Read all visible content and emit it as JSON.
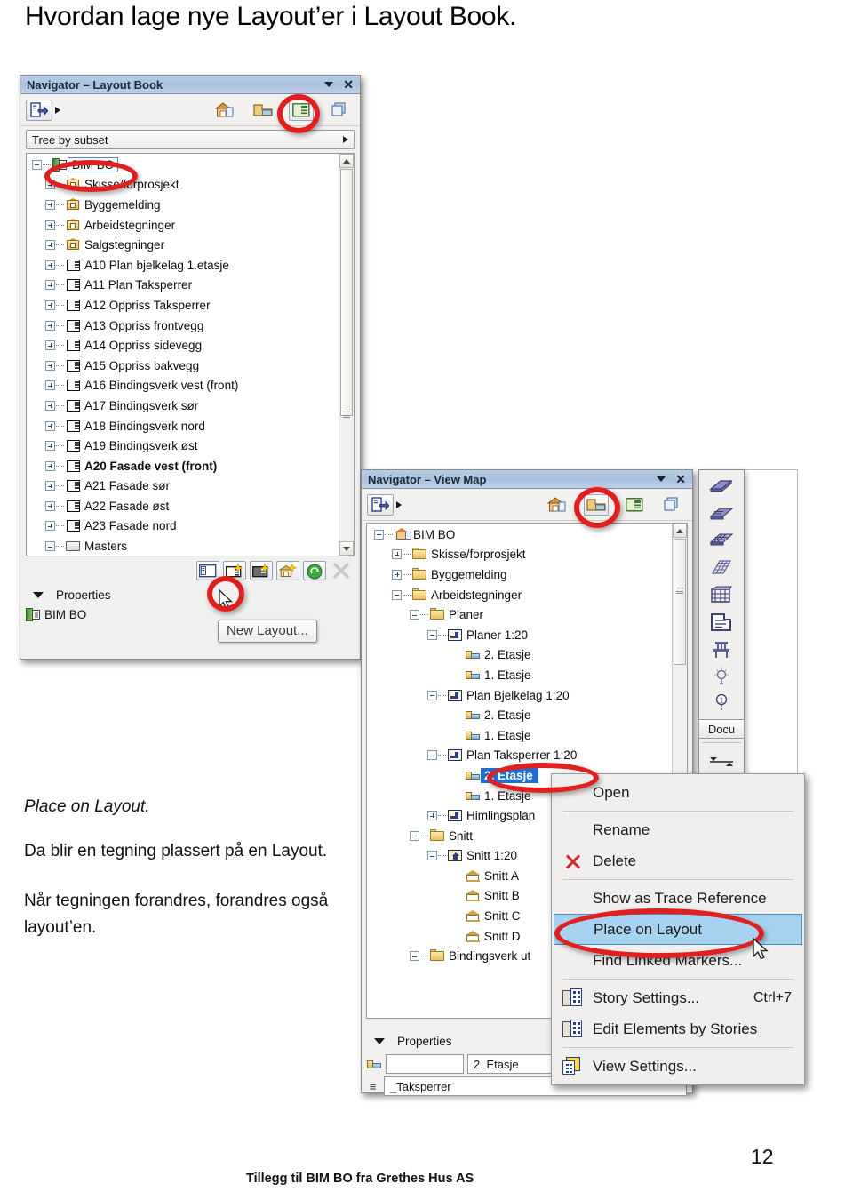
{
  "document": {
    "title": "Hvordan lage nye Layout’er i Layout Book.",
    "footer": "Tillegg til BIM BO fra Grethes Hus AS",
    "page_number": "12"
  },
  "body_text": {
    "italic_line": "Place on Layout.",
    "paragraph1": "Da blir en tegning plassert på en Layout.",
    "paragraph2": "Når tegningen forandres, forandres også layout’en."
  },
  "layout_book_panel": {
    "title": "Navigator – Layout Book",
    "caret_icon": "chevron-down-icon",
    "close_icon": "close-icon",
    "toolbar": {
      "publisher_icon": "publisher-arrow-icon",
      "project_map_icon": "project-map-icon",
      "view_map_icon": "view-map-icon",
      "layout_book_icon": "layout-book-icon",
      "publisher_sets_icon": "publisher-sets-icon"
    },
    "combo_value": "Tree by subset",
    "combo_arrow_icon": "chevron-right-icon",
    "tree": [
      {
        "label": "BIM BO",
        "icon": "layout-book-root-icon",
        "indent": 0,
        "expander": "minus",
        "selected": true,
        "bold": false
      },
      {
        "label": "Skisse/forprosjekt",
        "icon": "subset-icon",
        "indent": 1,
        "expander": "plus",
        "selected": false,
        "bold": false
      },
      {
        "label": "Byggemelding",
        "icon": "subset-icon",
        "indent": 1,
        "expander": "plus",
        "selected": false,
        "bold": false
      },
      {
        "label": "Arbeidstegninger",
        "icon": "subset-icon",
        "indent": 1,
        "expander": "plus",
        "selected": false,
        "bold": false
      },
      {
        "label": "Salgstegninger",
        "icon": "subset-icon",
        "indent": 1,
        "expander": "plus",
        "selected": false,
        "bold": false
      },
      {
        "label": "A10 Plan bjelkelag 1.etasje",
        "icon": "layout-icon",
        "indent": 1,
        "expander": "plus",
        "selected": false,
        "bold": false
      },
      {
        "label": "A11 Plan Taksperrer",
        "icon": "layout-icon",
        "indent": 1,
        "expander": "plus",
        "selected": false,
        "bold": false
      },
      {
        "label": "A12 Oppriss Taksperrer",
        "icon": "layout-icon",
        "indent": 1,
        "expander": "plus",
        "selected": false,
        "bold": false
      },
      {
        "label": "A13 Oppriss frontvegg",
        "icon": "layout-icon",
        "indent": 1,
        "expander": "plus",
        "selected": false,
        "bold": false
      },
      {
        "label": "A14 Oppriss sidevegg",
        "icon": "layout-icon",
        "indent": 1,
        "expander": "plus",
        "selected": false,
        "bold": false
      },
      {
        "label": "A15 Oppriss bakvegg",
        "icon": "layout-icon",
        "indent": 1,
        "expander": "plus",
        "selected": false,
        "bold": false
      },
      {
        "label": "A16 Bindingsverk vest (front)",
        "icon": "layout-icon",
        "indent": 1,
        "expander": "plus",
        "selected": false,
        "bold": false
      },
      {
        "label": "A17 Bindingsverk sør",
        "icon": "layout-icon",
        "indent": 1,
        "expander": "plus",
        "selected": false,
        "bold": false
      },
      {
        "label": "A18 Bindingsverk nord",
        "icon": "layout-icon",
        "indent": 1,
        "expander": "plus",
        "selected": false,
        "bold": false
      },
      {
        "label": "A19 Bindingsverk øst",
        "icon": "layout-icon",
        "indent": 1,
        "expander": "plus",
        "selected": false,
        "bold": false
      },
      {
        "label": "A20 Fasade vest (front)",
        "icon": "layout-icon",
        "indent": 1,
        "expander": "plus",
        "selected": false,
        "bold": true
      },
      {
        "label": "A21 Fasade sør",
        "icon": "layout-icon",
        "indent": 1,
        "expander": "plus",
        "selected": false,
        "bold": false
      },
      {
        "label": "A22 Fasade øst",
        "icon": "layout-icon",
        "indent": 1,
        "expander": "plus",
        "selected": false,
        "bold": false
      },
      {
        "label": "A23 Fasade nord",
        "icon": "layout-icon",
        "indent": 1,
        "expander": "plus",
        "selected": false,
        "bold": false
      },
      {
        "label": "Masters",
        "icon": "masters-folder-icon",
        "indent": 1,
        "expander": "minus",
        "selected": false,
        "bold": false
      }
    ],
    "bottom_buttons": [
      "new-independent-layout-icon",
      "new-layout-icon",
      "new-master-layout-icon",
      "new-subset-icon",
      "update-icon",
      "delete-icon"
    ],
    "tooltip": "New Layout...",
    "properties_label": "Properties",
    "properties_value": "BIM BO"
  },
  "view_map_panel": {
    "title": "Navigator – View Map",
    "caret_icon": "chevron-down-icon",
    "close_icon": "close-icon",
    "toolbar": {
      "publisher_icon": "publisher-arrow-icon",
      "project_map_icon": "project-map-icon",
      "view_map_icon": "view-map-icon",
      "layout_book_icon": "layout-book-icon",
      "publisher_sets_icon": "publisher-sets-icon"
    },
    "tree": [
      {
        "label": "BIM BO",
        "icon": "project-icon",
        "indent": 0,
        "expander": "minus",
        "selected": false
      },
      {
        "label": "Skisse/forprosjekt",
        "icon": "folder-icon",
        "indent": 1,
        "expander": "plus",
        "selected": false
      },
      {
        "label": "Byggemelding",
        "icon": "folder-icon",
        "indent": 1,
        "expander": "plus",
        "selected": false
      },
      {
        "label": "Arbeidstegninger",
        "icon": "folder-icon",
        "indent": 1,
        "expander": "minus",
        "selected": false
      },
      {
        "label": "Planer",
        "icon": "folder-icon",
        "indent": 2,
        "expander": "minus",
        "selected": false
      },
      {
        "label": "Planer 1:20",
        "icon": "viewset-icon",
        "indent": 3,
        "expander": "minus",
        "selected": false
      },
      {
        "label": "2. Etasje",
        "icon": "view-icon",
        "indent": 4,
        "expander": "none",
        "selected": false
      },
      {
        "label": "1. Etasje",
        "icon": "view-icon",
        "indent": 4,
        "expander": "none",
        "selected": false
      },
      {
        "label": "Plan Bjelkelag 1:20",
        "icon": "viewset-icon",
        "indent": 3,
        "expander": "minus",
        "selected": false
      },
      {
        "label": "2. Etasje",
        "icon": "view-icon",
        "indent": 4,
        "expander": "none",
        "selected": false
      },
      {
        "label": "1. Etasje",
        "icon": "view-icon",
        "indent": 4,
        "expander": "none",
        "selected": false
      },
      {
        "label": "Plan Taksperrer 1:20",
        "icon": "viewset-icon",
        "indent": 3,
        "expander": "minus",
        "selected": false
      },
      {
        "label": "2. Etasje",
        "icon": "view-icon",
        "indent": 4,
        "expander": "none",
        "selected": true
      },
      {
        "label": "1. Etasje",
        "icon": "view-icon",
        "indent": 4,
        "expander": "none",
        "selected": false
      },
      {
        "label": "Himlingsplan",
        "icon": "viewset-icon",
        "indent": 3,
        "expander": "plus",
        "selected": false
      },
      {
        "label": "Snitt",
        "icon": "folder-icon",
        "indent": 2,
        "expander": "minus",
        "selected": false
      },
      {
        "label": "Snitt 1:20",
        "icon": "section-set-icon",
        "indent": 3,
        "expander": "minus",
        "selected": false
      },
      {
        "label": "Snitt A",
        "icon": "section-icon",
        "indent": 4,
        "expander": "none",
        "selected": false
      },
      {
        "label": "Snitt B",
        "icon": "section-icon",
        "indent": 4,
        "expander": "none",
        "selected": false
      },
      {
        "label": "Snitt C",
        "icon": "section-icon",
        "indent": 4,
        "expander": "none",
        "selected": false
      },
      {
        "label": "Snitt D",
        "icon": "section-icon",
        "indent": 4,
        "expander": "none",
        "selected": false
      },
      {
        "label": "Bindingsverk ut",
        "icon": "folder-icon",
        "indent": 2,
        "expander": "minus",
        "selected": false
      }
    ],
    "properties_label": "Properties",
    "properties_fields": {
      "left_value": "",
      "right_value": "2. Etasje",
      "second_row_value": "_Taksperrer"
    }
  },
  "context_menu": {
    "items": [
      {
        "label": "Open",
        "icon": "",
        "accel": "",
        "selected": false,
        "separator_after": true
      },
      {
        "label": "Rename",
        "icon": "",
        "accel": "",
        "selected": false,
        "separator_after": false
      },
      {
        "label": "Delete",
        "icon": "delete-x-icon",
        "accel": "",
        "selected": false,
        "separator_after": true
      },
      {
        "label": "Show as Trace Reference",
        "icon": "",
        "accel": "",
        "selected": false,
        "separator_after": false
      },
      {
        "label": "Place on Layout",
        "icon": "",
        "accel": "",
        "selected": true,
        "separator_after": false
      },
      {
        "label": "Find Linked Markers...",
        "icon": "",
        "accel": "",
        "selected": false,
        "separator_after": true
      },
      {
        "label": "Story Settings...",
        "icon": "story-settings-icon",
        "accel": "Ctrl+7",
        "selected": false,
        "separator_after": false
      },
      {
        "label": "Edit Elements by Stories",
        "icon": "story-settings-icon",
        "accel": "",
        "selected": false,
        "separator_after": true
      },
      {
        "label": "View Settings...",
        "icon": "view-settings-icon",
        "accel": "",
        "selected": false,
        "separator_after": false
      }
    ]
  },
  "toolbox": {
    "items": [
      "roof-tool-icon",
      "slab-tool-icon",
      "mesh-tool-icon",
      "shell-tool-icon",
      "curtain-wall-tool-icon",
      "zone-tool-icon",
      "object-tool-icon",
      "lamp-tool-icon",
      "label-tool-icon"
    ],
    "label": "Docu",
    "dimension_icon": "dimension-tool-icon"
  },
  "colors": {
    "titlebar": "#aec6e0",
    "selection": "#a8d3f0",
    "annotation_red": "#e02020",
    "panel_bg": "#f0f0ef"
  }
}
